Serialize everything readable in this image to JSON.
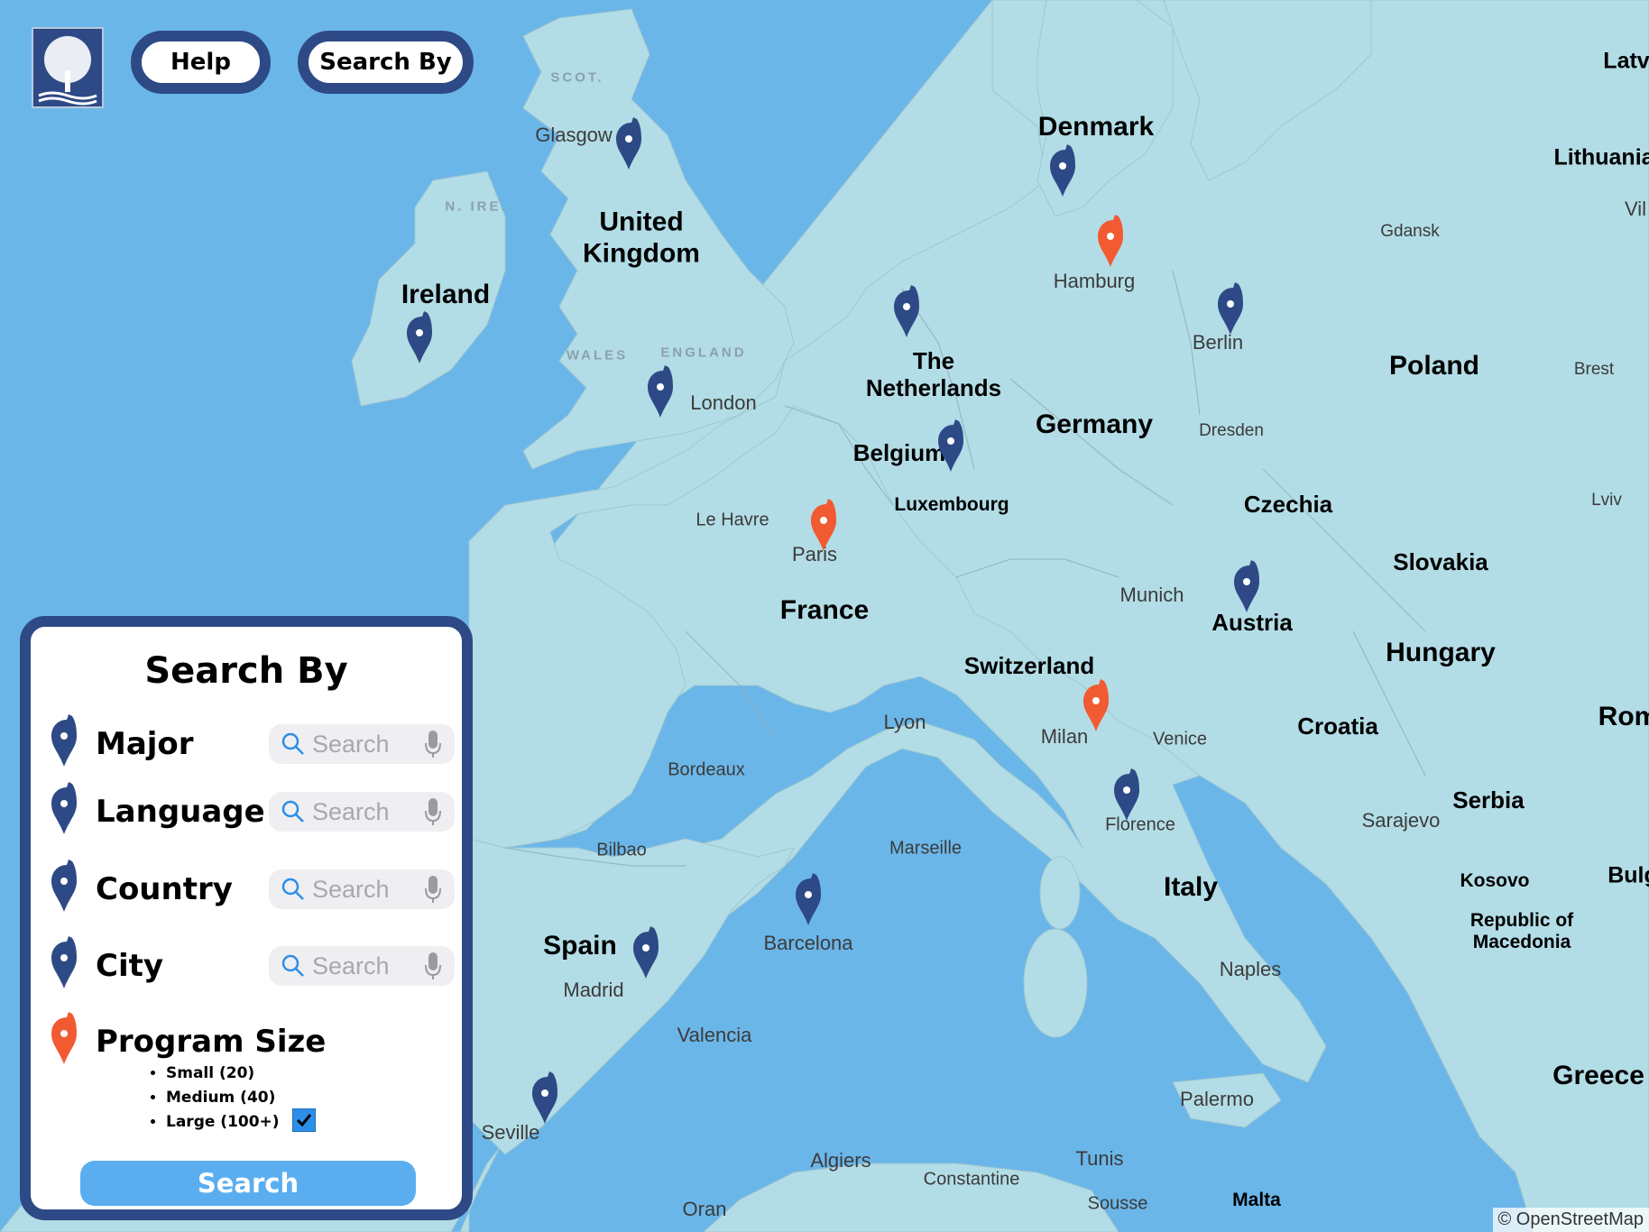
{
  "header": {
    "help_label": "Help",
    "search_by_label": "Search By"
  },
  "map": {
    "country_labels": [
      "Denmark",
      "United Kingdom",
      "Ireland",
      "The Netherlands",
      "Belgium",
      "Luxembourg",
      "Germany",
      "Poland",
      "Czechia",
      "Slovakia",
      "Austria",
      "Hungary",
      "Switzerland",
      "France",
      "Croatia",
      "Serbia",
      "Italy",
      "Spain",
      "Kosovo",
      "Republic of Macedonia",
      "Greece",
      "Lithuania",
      "Latv",
      "Rom",
      "Bulg",
      "Malta"
    ],
    "region_labels": [
      "SCOT.",
      "N. IRE.",
      "WALES",
      "ENGLAND"
    ],
    "city_labels": [
      "Glasgow",
      "London",
      "Hamburg",
      "Berlin",
      "Gdansk",
      "Brest",
      "Dresden",
      "Le Havre",
      "Paris",
      "Munich",
      "Lviv",
      "Lyon",
      "Milan",
      "Venice",
      "Bordeaux",
      "Florence",
      "Sarajevo",
      "Bilbao",
      "Marseille",
      "Barcelona",
      "Madrid",
      "Naples",
      "Valencia",
      "Seville",
      "Palermo",
      "Algiers",
      "Tunis",
      "Constantine",
      "Oran",
      "Sousse",
      "Vil"
    ],
    "pin_colors": {
      "standard": "#2e4a86",
      "large_program": "#f25a32"
    },
    "attribution": "© OpenStreetMap"
  },
  "panel": {
    "title": "Search By",
    "rows": [
      {
        "label": "Major",
        "placeholder": "Search"
      },
      {
        "label": "Language",
        "placeholder": "Search"
      },
      {
        "label": "Country",
        "placeholder": "Search"
      },
      {
        "label": "City",
        "placeholder": "Search"
      }
    ],
    "program_size": {
      "label": "Program Size",
      "options": [
        "Small (20)",
        "Medium (40)",
        "Large (100+)"
      ],
      "checked": "Large (100+)"
    },
    "search_button": "Search"
  }
}
